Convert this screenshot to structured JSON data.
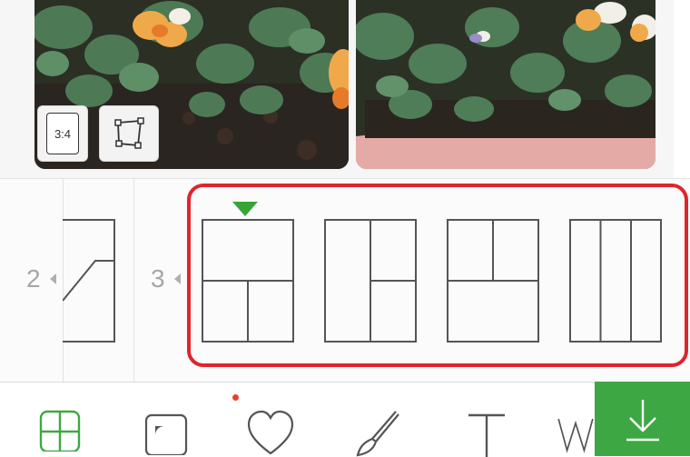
{
  "photo_tools": {
    "ratio_label": "3:4",
    "ratio_icon": "aspect-ratio-icon",
    "freeform_icon": "freeform-crop-icon"
  },
  "layout_strip": {
    "groups": [
      {
        "count": "2",
        "arrow_icon": "caret-left-icon"
      },
      {
        "count": "3",
        "arrow_icon": "caret-left-icon"
      }
    ],
    "layouts": [
      {
        "name": "top-full-bottom-split",
        "selected": true
      },
      {
        "name": "left-full-right-split",
        "selected": false
      },
      {
        "name": "top-split-bottom-full",
        "selected": false
      },
      {
        "name": "three-columns",
        "selected": false
      }
    ],
    "selected_marker_color": "#36a536",
    "highlight_color": "#e0242c"
  },
  "toolbar": {
    "items": [
      {
        "icon": "layout-icon",
        "active": true
      },
      {
        "icon": "frame-icon",
        "active": false
      },
      {
        "icon": "heart-icon",
        "active": false,
        "badge_dot": true
      },
      {
        "icon": "brush-icon",
        "active": false
      },
      {
        "icon": "text-icon",
        "active": false
      },
      {
        "icon": "watermark-icon",
        "active": false
      }
    ],
    "save_icon": "download-icon",
    "active_color": "#3da843",
    "badge_color": "#e8412c"
  }
}
